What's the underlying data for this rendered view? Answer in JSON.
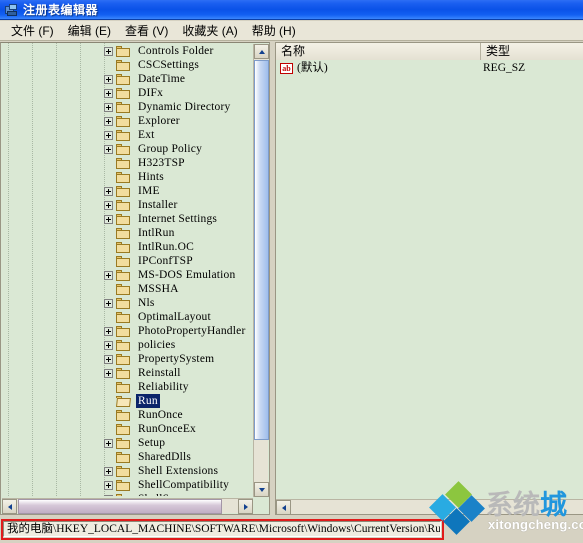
{
  "window": {
    "title": "注册表编辑器",
    "icon": "registry-editor-icon"
  },
  "menubar": {
    "items": [
      {
        "label": "文件 (F)",
        "name": "menu-file"
      },
      {
        "label": "编辑 (E)",
        "name": "menu-edit"
      },
      {
        "label": "查看 (V)",
        "name": "menu-view"
      },
      {
        "label": "收藏夹 (A)",
        "name": "menu-favorites"
      },
      {
        "label": "帮助 (H)",
        "name": "menu-help"
      }
    ]
  },
  "tree": {
    "selected_key": "Run",
    "items": [
      {
        "label": "Controls Folder",
        "expandable": true,
        "selected": false
      },
      {
        "label": "CSCSettings",
        "expandable": false,
        "selected": false
      },
      {
        "label": "DateTime",
        "expandable": true,
        "selected": false
      },
      {
        "label": "DIFx",
        "expandable": true,
        "selected": false
      },
      {
        "label": "Dynamic Directory",
        "expandable": true,
        "selected": false
      },
      {
        "label": "Explorer",
        "expandable": true,
        "selected": false
      },
      {
        "label": "Ext",
        "expandable": true,
        "selected": false
      },
      {
        "label": "Group Policy",
        "expandable": true,
        "selected": false
      },
      {
        "label": "H323TSP",
        "expandable": false,
        "selected": false
      },
      {
        "label": "Hints",
        "expandable": false,
        "selected": false
      },
      {
        "label": "IME",
        "expandable": true,
        "selected": false
      },
      {
        "label": "Installer",
        "expandable": true,
        "selected": false
      },
      {
        "label": "Internet Settings",
        "expandable": true,
        "selected": false
      },
      {
        "label": "IntlRun",
        "expandable": false,
        "selected": false
      },
      {
        "label": "IntlRun.OC",
        "expandable": false,
        "selected": false
      },
      {
        "label": "IPConfTSP",
        "expandable": false,
        "selected": false
      },
      {
        "label": "MS-DOS Emulation",
        "expandable": true,
        "selected": false
      },
      {
        "label": "MSSHA",
        "expandable": false,
        "selected": false
      },
      {
        "label": "Nls",
        "expandable": true,
        "selected": false
      },
      {
        "label": "OptimalLayout",
        "expandable": false,
        "selected": false
      },
      {
        "label": "PhotoPropertyHandler",
        "expandable": true,
        "selected": false
      },
      {
        "label": "policies",
        "expandable": true,
        "selected": false
      },
      {
        "label": "PropertySystem",
        "expandable": true,
        "selected": false
      },
      {
        "label": "Reinstall",
        "expandable": true,
        "selected": false
      },
      {
        "label": "Reliability",
        "expandable": false,
        "selected": false
      },
      {
        "label": "Run",
        "expandable": false,
        "selected": true
      },
      {
        "label": "RunOnce",
        "expandable": false,
        "selected": false
      },
      {
        "label": "RunOnceEx",
        "expandable": false,
        "selected": false
      },
      {
        "label": "Setup",
        "expandable": true,
        "selected": false
      },
      {
        "label": "SharedDlls",
        "expandable": false,
        "selected": false
      },
      {
        "label": "Shell Extensions",
        "expandable": true,
        "selected": false
      },
      {
        "label": "ShellCompatibility",
        "expandable": true,
        "selected": false
      },
      {
        "label": "ShellScrap",
        "expandable": true,
        "selected": false
      }
    ]
  },
  "list": {
    "columns": [
      {
        "label": "名称",
        "name": "column-name"
      },
      {
        "label": "类型",
        "name": "column-type"
      }
    ],
    "rows": [
      {
        "icon": "string-value-icon",
        "icon_text": "ab",
        "name": "(默认)",
        "type": "REG_SZ"
      }
    ]
  },
  "statusbar": {
    "path": "我的电脑\\HKEY_LOCAL_MACHINE\\SOFTWARE\\Microsoft\\Windows\\CurrentVersion\\Run",
    "highlight_color": "#e01b1b"
  },
  "watermark": {
    "brand_part1": "系统",
    "brand_part2": "城",
    "url": "xitongcheng.com",
    "colors": {
      "green": "#8cc63f",
      "blue": "#29abe2",
      "accent": "#2196dd"
    }
  }
}
